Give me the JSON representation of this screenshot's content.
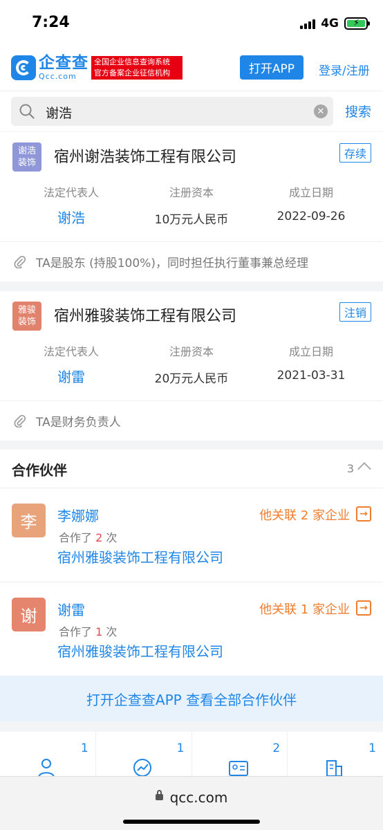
{
  "status_bar": {
    "time": "7:24",
    "network": "4G"
  },
  "header": {
    "logo_cn": "企查查",
    "logo_en": "Qcc.com",
    "badge_line1": "全国企业信息查询系统",
    "badge_line2": "官方备案企业征信机构",
    "open_app": "打开APP",
    "login": "登录/注册"
  },
  "search": {
    "query": "谢浩",
    "button": "搜索"
  },
  "labels": {
    "legal_rep": "法定代表人",
    "capital": "注册资本",
    "founded": "成立日期"
  },
  "companies": [
    {
      "avatar_text": "谢浩装饰",
      "avatar_color": "#8f97d9",
      "name": "宿州谢浩装饰工程有限公司",
      "status": "存续",
      "legal_rep": "谢浩",
      "capital": "10万元人民币",
      "founded": "2022-09-26",
      "note": "TA是股东 (持股100%)，同时担任执行董事兼总经理"
    },
    {
      "avatar_text": "雅骏装饰",
      "avatar_color": "#e0826c",
      "name": "宿州雅骏装饰工程有限公司",
      "status": "注销",
      "legal_rep": "谢雷",
      "capital": "20万元人民币",
      "founded": "2021-03-31",
      "note": "TA是财务负责人"
    }
  ],
  "partners": {
    "title": "合作伙伴",
    "count": "3",
    "items": [
      {
        "avatar": "李",
        "avatar_color": "#e8a37a",
        "name": "李娜娜",
        "times_prefix": "合作了 ",
        "times": "2",
        "times_suffix": " 次",
        "company": "宿州雅骏装饰工程有限公司",
        "related": "他关联 2 家企业"
      },
      {
        "avatar": "谢",
        "avatar_color": "#e5856e",
        "name": "谢雷",
        "times_prefix": "合作了 ",
        "times": "1",
        "times_suffix": " 次",
        "company": "宿州雅骏装饰工程有限公司",
        "related": "他关联 1 家企业"
      }
    ],
    "open_all": "打开企查查APP 查看全部合作伙伴"
  },
  "bottom_tabs": [
    {
      "icon": "person-icon",
      "count": "1"
    },
    {
      "icon": "trend-icon",
      "count": "1"
    },
    {
      "icon": "id-card-icon",
      "count": "2"
    },
    {
      "icon": "building-icon",
      "count": "1"
    }
  ],
  "browser": {
    "url": "qcc.com"
  }
}
